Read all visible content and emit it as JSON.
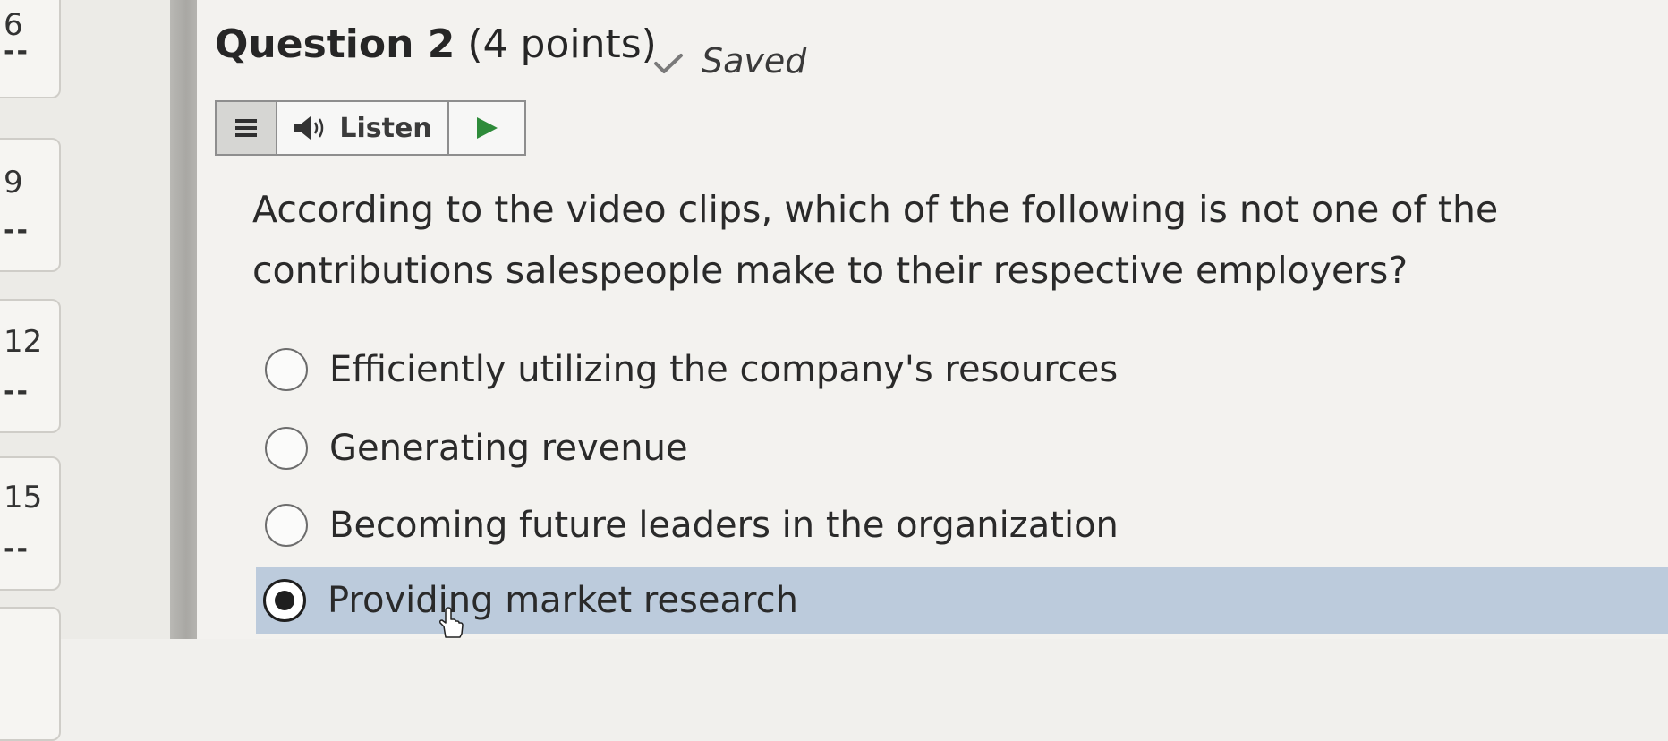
{
  "nav": {
    "items": [
      {
        "number": "6",
        "status": "--"
      },
      {
        "number": "9",
        "status": "--"
      },
      {
        "number": "12",
        "status": "--"
      },
      {
        "number": "15",
        "status": "--"
      }
    ]
  },
  "question": {
    "title_strong": "Question 2",
    "title_points": " (4 points)",
    "saved_label": "Saved",
    "text": "According to the video clips, which of the following is not one of the contributions salespeople make to their respective employers?",
    "options": [
      {
        "label": "Efficiently utilizing the company's resources",
        "selected": false
      },
      {
        "label": "Generating revenue",
        "selected": false
      },
      {
        "label": "Becoming future leaders in the organization",
        "selected": false
      },
      {
        "label": "Providing market research",
        "selected": true
      }
    ]
  },
  "listen": {
    "label": "Listen",
    "menu_icon": "hamburger-icon",
    "speaker_icon": "speaker-icon",
    "play_icon": "play-icon"
  },
  "colors": {
    "selected_bg": "#bccbdc",
    "play_green": "#2e8b3a",
    "check_gray": "#7a7a7a"
  }
}
